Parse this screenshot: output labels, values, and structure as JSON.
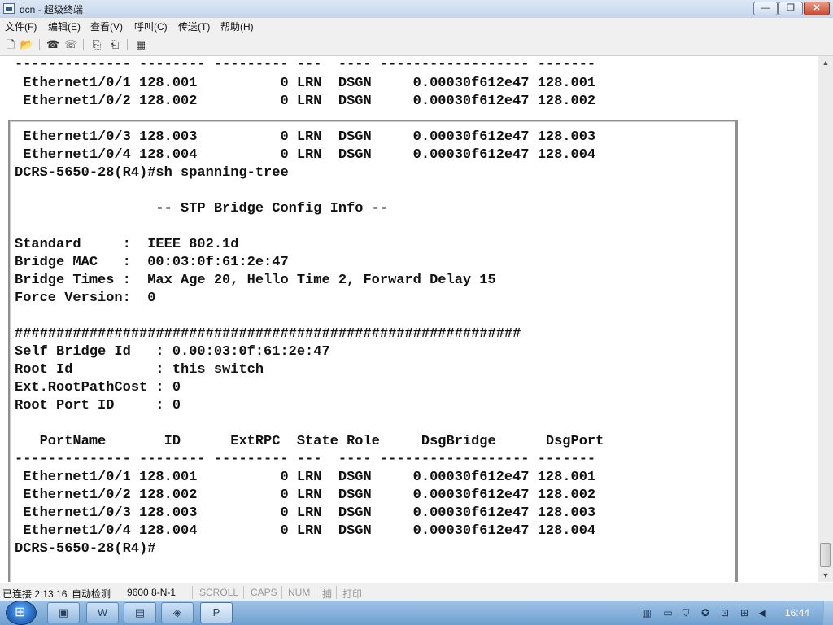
{
  "window": {
    "title": "dcn - 超级终端",
    "min_glyph": "—",
    "max_glyph": "❐",
    "close_glyph": "✕"
  },
  "menu": [
    "文件(F)",
    "编辑(E)",
    "查看(V)",
    "呼叫(C)",
    "传送(T)",
    "帮助(H)"
  ],
  "toolbar": {
    "buttons": [
      {
        "icon": "new-icon",
        "glyph": "🗋"
      },
      {
        "icon": "open-icon",
        "glyph": "📂"
      },
      {
        "icon": "call-icon",
        "glyph": "☎"
      },
      {
        "icon": "disconnect-icon",
        "glyph": "☏"
      },
      {
        "icon": "send-icon",
        "glyph": "⎘"
      },
      {
        "icon": "receive-icon",
        "glyph": "⎗"
      },
      {
        "icon": "properties-icon",
        "glyph": "▦"
      }
    ]
  },
  "terminal": {
    "top_pane": [
      "-------------- -------- --------- ---  ---- ------------------ -------",
      " Ethernet1/0/1 128.001          0 LRN  DSGN     0.00030f612e47 128.001",
      " Ethernet1/0/2 128.002          0 LRN  DSGN     0.00030f612e47 128.002"
    ],
    "bottom_pane": [
      " Ethernet1/0/3 128.003          0 LRN  DSGN     0.00030f612e47 128.003",
      " Ethernet1/0/4 128.004          0 LRN  DSGN     0.00030f612e47 128.004",
      "DCRS-5650-28(R4)#sh spanning-tree",
      "",
      "                 -- STP Bridge Config Info --",
      "",
      "Standard     :  IEEE 802.1d",
      "Bridge MAC   :  00:03:0f:61:2e:47",
      "Bridge Times :  Max Age 20, Hello Time 2, Forward Delay 15",
      "Force Version:  0",
      "",
      "#############################################################",
      "Self Bridge Id   : 0.00:03:0f:61:2e:47",
      "Root Id          : this switch",
      "Ext.RootPathCost : 0",
      "Root Port ID     : 0",
      "",
      "   PortName       ID      ExtRPC  State Role     DsgBridge      DsgPort",
      "-------------- -------- --------- ---  ---- ------------------ -------",
      " Ethernet1/0/1 128.001          0 LRN  DSGN     0.00030f612e47 128.001",
      " Ethernet1/0/2 128.002          0 LRN  DSGN     0.00030f612e47 128.002",
      " Ethernet1/0/3 128.003          0 LRN  DSGN     0.00030f612e47 128.003",
      " Ethernet1/0/4 128.004          0 LRN  DSGN     0.00030f612e47 128.004",
      "DCRS-5650-28(R4)#"
    ]
  },
  "scrollbar": {
    "up_glyph": "▲",
    "down_glyph": "▼"
  },
  "status": {
    "connection": "已连接 2:13:16",
    "detect": "自动检测",
    "params": "9600 8-N-1",
    "scroll": "SCROLL",
    "caps": "CAPS",
    "num": "NUM",
    "capture": "捕",
    "print": "打印"
  },
  "taskbar": {
    "clock": "16:44",
    "apps": [
      {
        "icon": "explorer-icon",
        "glyph": "▣"
      },
      {
        "icon": "word-icon",
        "glyph": "W"
      },
      {
        "icon": "folder-icon",
        "glyph": "▤"
      },
      {
        "icon": "network-app-icon",
        "glyph": "◈"
      },
      {
        "icon": "powerpoint-icon",
        "glyph": "P"
      }
    ],
    "tray": [
      {
        "icon": "film-icon",
        "glyph": "▥"
      },
      {
        "icon": "monitor-icon",
        "glyph": "▭"
      },
      {
        "icon": "shield-icon",
        "glyph": "⛉"
      },
      {
        "icon": "security-icon",
        "glyph": "✪"
      },
      {
        "icon": "device-icon",
        "glyph": "⊡"
      },
      {
        "icon": "network-icon",
        "glyph": "⊞"
      },
      {
        "icon": "volume-icon",
        "glyph": "◀"
      }
    ]
  }
}
